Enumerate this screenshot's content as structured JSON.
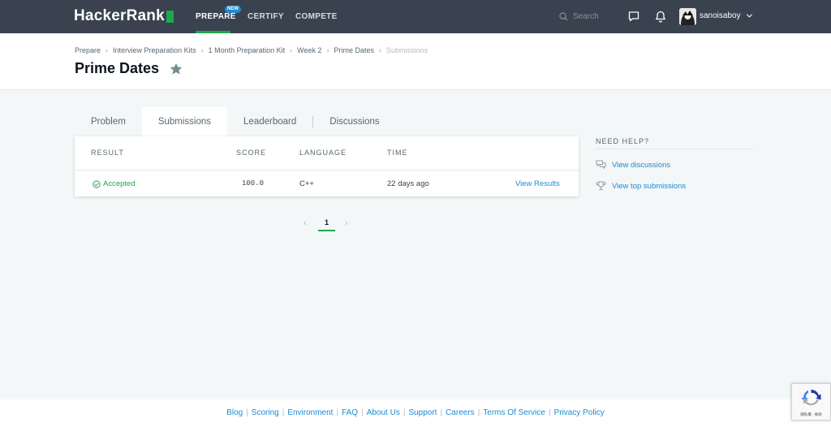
{
  "nav": {
    "logo": "HackerRank",
    "items": [
      "PREPARE",
      "CERTIFY",
      "COMPETE"
    ],
    "new_badge": "NEW",
    "search_placeholder": "Search",
    "username": "sanoisaboy",
    "accent": "#1ba94c",
    "bg": "#39424e"
  },
  "breadcrumb": [
    "Prepare",
    "Interview Preparation Kits",
    "1 Month Preparation Kit",
    "Week 2",
    "Prime Dates",
    "Submissions"
  ],
  "page_title": "Prime Dates",
  "tabs": [
    "Problem",
    "Submissions",
    "Leaderboard",
    "Discussions"
  ],
  "table": {
    "headers": [
      "RESULT",
      "SCORE",
      "LANGUAGE",
      "TIME"
    ],
    "rows": [
      {
        "result": "Accepted",
        "score": "100.0",
        "language": "C++",
        "time": "22 days ago",
        "action": "View Results"
      }
    ]
  },
  "pagination": {
    "current": "1",
    "prev": "‹",
    "next": "›"
  },
  "help": {
    "title": "NEED HELP?",
    "links": [
      "View discussions",
      "View top submissions"
    ]
  },
  "footer": [
    "Blog",
    "Scoring",
    "Environment",
    "FAQ",
    "About Us",
    "Support",
    "Careers",
    "Terms Of Service",
    "Privacy Policy"
  ],
  "recaptcha_text": "隱私權 - 條款"
}
